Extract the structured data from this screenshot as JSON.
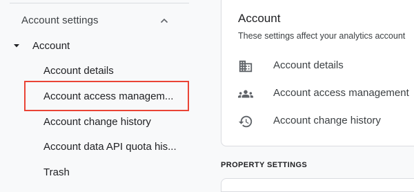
{
  "sidebar": {
    "section_title": "Account settings",
    "group_label": "Account",
    "items": [
      {
        "label": "Account details"
      },
      {
        "label": "Account access managem..."
      },
      {
        "label": "Account change history"
      },
      {
        "label": "Account data API quota his..."
      },
      {
        "label": "Trash"
      }
    ]
  },
  "main": {
    "card": {
      "title": "Account",
      "subtitle": "These settings affect your analytics account",
      "rows": [
        {
          "icon": "building-icon",
          "label": "Account details"
        },
        {
          "icon": "people-icon",
          "label": "Account access management"
        },
        {
          "icon": "history-icon",
          "label": "Account change history"
        }
      ]
    },
    "property_settings_label": "PROPERTY SETTINGS"
  },
  "colors": {
    "highlight": "#ea4335",
    "text_primary": "#202124",
    "text_secondary": "#3c4043",
    "background": "#f8f9fa",
    "card": "#ffffff",
    "border": "#dadce0"
  }
}
